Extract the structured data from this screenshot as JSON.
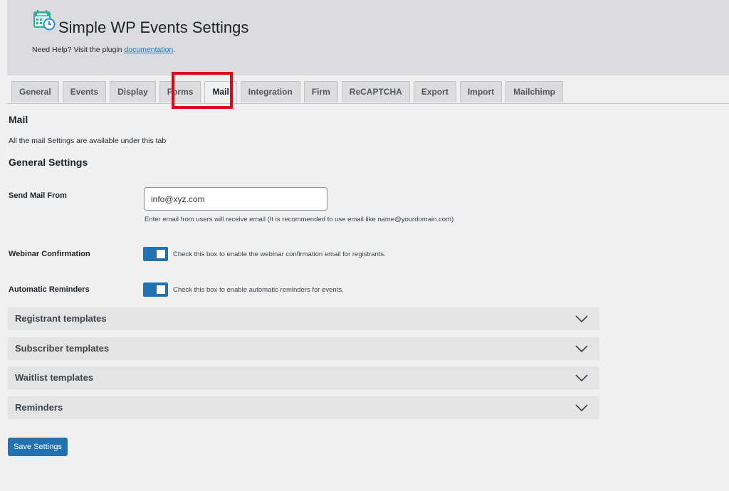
{
  "header": {
    "title": "Simple WP Events Settings",
    "help_prefix": "Need Help? Visit the plugin ",
    "help_link": "documentation",
    "help_suffix": "."
  },
  "tabs": [
    {
      "label": "General"
    },
    {
      "label": "Events"
    },
    {
      "label": "Display"
    },
    {
      "label": "Forms"
    },
    {
      "label": "Mail",
      "active": true
    },
    {
      "label": "Integration"
    },
    {
      "label": "Firm"
    },
    {
      "label": "ReCAPTCHA"
    },
    {
      "label": "Export"
    },
    {
      "label": "Import"
    },
    {
      "label": "Mailchimp"
    }
  ],
  "section": {
    "title": "Mail",
    "description": "All the mail Settings are available under this tab",
    "general_heading": "General Settings"
  },
  "fields": {
    "send_mail_from": {
      "label": "Send Mail From",
      "value": "info@xyz.com",
      "hint": "Enter email from users will receive email (It is recommended to use email like name@yourdomain.com)"
    },
    "webinar_confirmation": {
      "label": "Webinar Confirmation",
      "checked": true,
      "text": "Check this box to enable the webinar confirmation email for registrants."
    },
    "automatic_reminders": {
      "label": "Automatic Reminders",
      "checked": true,
      "text": "Check this box to enable automatic reminders for events."
    }
  },
  "accordions": [
    {
      "label": "Registrant templates"
    },
    {
      "label": "Subscriber templates"
    },
    {
      "label": "Waitlist templates"
    },
    {
      "label": "Reminders"
    }
  ],
  "save_label": "Save Settings",
  "colors": {
    "accent": "#2271b1",
    "highlight": "#e30613",
    "header_bg": "#dcdcde"
  },
  "icons": {
    "logo": "calendar-clock-icon",
    "accordion": "chevron-down-icon"
  }
}
